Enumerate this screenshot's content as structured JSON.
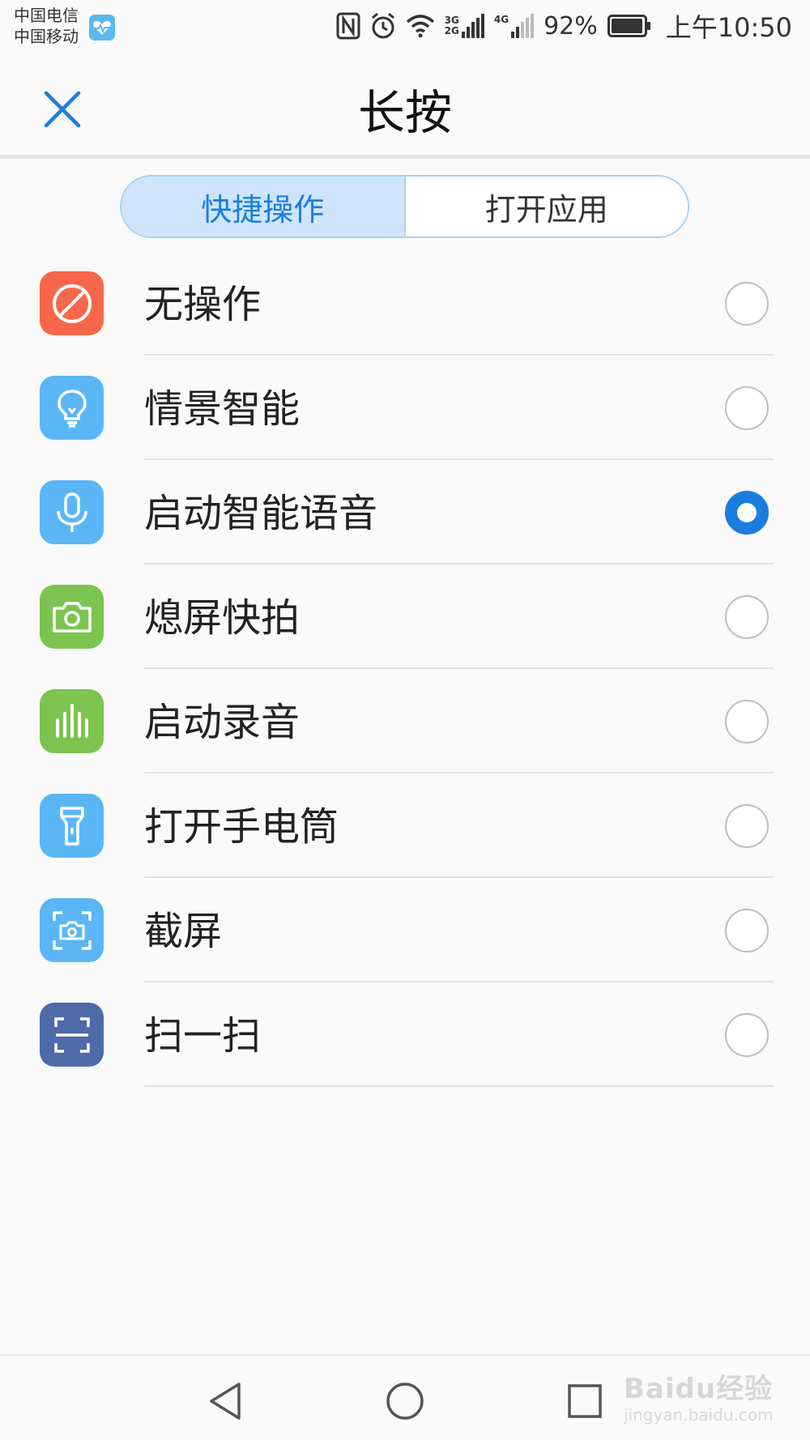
{
  "status_bar": {
    "carrier_1": "中国电信",
    "carrier_2": "中国移动",
    "network_1": "3G",
    "network_2": "2G",
    "network_3": "4G",
    "battery_percent": "92%",
    "time": "上午10:50"
  },
  "header": {
    "title": "长按"
  },
  "tabs": [
    {
      "label": "快捷操作",
      "active": true
    },
    {
      "label": "打开应用",
      "active": false
    }
  ],
  "options": [
    {
      "label": "无操作",
      "icon": "no-action-icon",
      "color": "#f8674a",
      "selected": false
    },
    {
      "label": "情景智能",
      "icon": "lightbulb-icon",
      "color": "#5bb6f5",
      "selected": false
    },
    {
      "label": "启动智能语音",
      "icon": "microphone-icon",
      "color": "#5bb6f5",
      "selected": true
    },
    {
      "label": "熄屏快拍",
      "icon": "camera-icon",
      "color": "#7cc44f",
      "selected": false
    },
    {
      "label": "启动录音",
      "icon": "audio-bars-icon",
      "color": "#7cc44f",
      "selected": false
    },
    {
      "label": "打开手电筒",
      "icon": "flashlight-icon",
      "color": "#5bb6f5",
      "selected": false
    },
    {
      "label": "截屏",
      "icon": "screenshot-icon",
      "color": "#5bb6f5",
      "selected": false
    },
    {
      "label": "扫一扫",
      "icon": "scan-icon",
      "color": "#4f6aa8",
      "selected": false
    }
  ],
  "accent_color": "#1a7ee0",
  "watermark": {
    "brand": "Baidu经验",
    "url": "jingyan.baidu.com"
  }
}
